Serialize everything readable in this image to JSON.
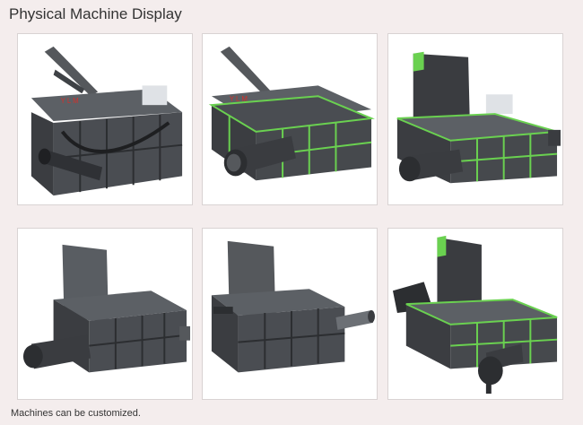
{
  "page": {
    "title": "Physical Machine Display",
    "footer": "Machines can be customized."
  },
  "gallery": {
    "items": [
      {
        "name": "machine-photo-1",
        "accent": "#3a3a3a"
      },
      {
        "name": "machine-photo-2",
        "accent": "#6ad150"
      },
      {
        "name": "machine-photo-3",
        "accent": "#6ad150"
      },
      {
        "name": "machine-photo-4",
        "accent": "#3a3a3a"
      },
      {
        "name": "machine-photo-5",
        "accent": "#3a3a3a"
      },
      {
        "name": "machine-photo-6",
        "accent": "#6ad150"
      }
    ]
  },
  "colors": {
    "background": "#f4eded",
    "machine_body": "#4a4d52",
    "machine_dark": "#2c2e31",
    "green_frame": "#6ad150",
    "logo_red": "#d2312c"
  }
}
